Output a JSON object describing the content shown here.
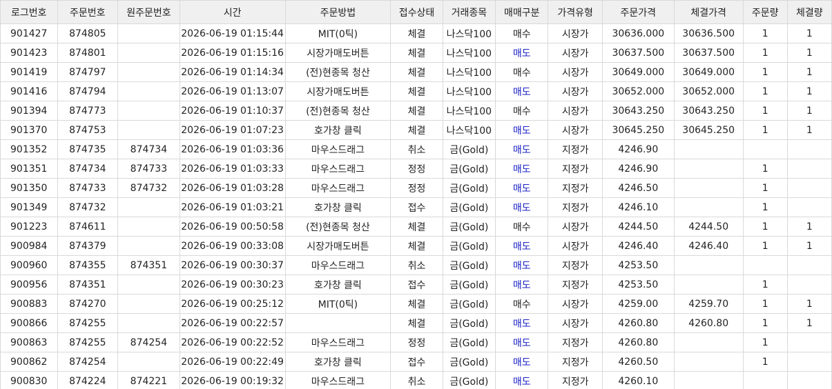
{
  "colors": {
    "header_bg": "#f0f0f0",
    "grid_line": "#d9d9d9",
    "sell_text": "#1a22c4",
    "text": "#222222"
  },
  "table": {
    "columns": [
      {
        "key": "log_no",
        "label": "로그번호"
      },
      {
        "key": "order_no",
        "label": "주문번호"
      },
      {
        "key": "orig_order_no",
        "label": "원주문번호"
      },
      {
        "key": "time",
        "label": "시간"
      },
      {
        "key": "method",
        "label": "주문방법"
      },
      {
        "key": "status",
        "label": "접수상태"
      },
      {
        "key": "symbol",
        "label": "거래종목"
      },
      {
        "key": "side",
        "label": "매매구분"
      },
      {
        "key": "price_type",
        "label": "가격유형"
      },
      {
        "key": "order_price",
        "label": "주문가격"
      },
      {
        "key": "fill_price",
        "label": "체결가격"
      },
      {
        "key": "order_qty",
        "label": "주문량"
      },
      {
        "key": "fill_qty",
        "label": "체결량"
      }
    ],
    "rows": [
      {
        "log_no": "901427",
        "order_no": "874805",
        "orig_order_no": "",
        "time": "2026-06-19 01:15:44",
        "method": "MIT(0틱)",
        "status": "체결",
        "symbol": "나스닥100",
        "side": "매수",
        "price_type": "시장가",
        "order_price": "30636.000",
        "fill_price": "30636.500",
        "order_qty": "1",
        "fill_qty": "1"
      },
      {
        "log_no": "901423",
        "order_no": "874801",
        "orig_order_no": "",
        "time": "2026-06-19 01:15:16",
        "method": "시장가매도버튼",
        "status": "체결",
        "symbol": "나스닥100",
        "side": "매도",
        "price_type": "시장가",
        "order_price": "30637.500",
        "fill_price": "30637.500",
        "order_qty": "1",
        "fill_qty": "1"
      },
      {
        "log_no": "901419",
        "order_no": "874797",
        "orig_order_no": "",
        "time": "2026-06-19 01:14:34",
        "method": "(전)현종목 청산",
        "status": "체결",
        "symbol": "나스닥100",
        "side": "매수",
        "price_type": "시장가",
        "order_price": "30649.000",
        "fill_price": "30649.000",
        "order_qty": "1",
        "fill_qty": "1"
      },
      {
        "log_no": "901416",
        "order_no": "874794",
        "orig_order_no": "",
        "time": "2026-06-19 01:13:07",
        "method": "시장가매도버튼",
        "status": "체결",
        "symbol": "나스닥100",
        "side": "매도",
        "price_type": "시장가",
        "order_price": "30652.000",
        "fill_price": "30652.000",
        "order_qty": "1",
        "fill_qty": "1"
      },
      {
        "log_no": "901394",
        "order_no": "874773",
        "orig_order_no": "",
        "time": "2026-06-19 01:10:37",
        "method": "(전)현종목 청산",
        "status": "체결",
        "symbol": "나스닥100",
        "side": "매수",
        "price_type": "시장가",
        "order_price": "30643.250",
        "fill_price": "30643.250",
        "order_qty": "1",
        "fill_qty": "1"
      },
      {
        "log_no": "901370",
        "order_no": "874753",
        "orig_order_no": "",
        "time": "2026-06-19 01:07:23",
        "method": "호가창 클릭",
        "status": "체결",
        "symbol": "나스닥100",
        "side": "매도",
        "price_type": "시장가",
        "order_price": "30645.250",
        "fill_price": "30645.250",
        "order_qty": "1",
        "fill_qty": "1"
      },
      {
        "log_no": "901352",
        "order_no": "874735",
        "orig_order_no": "874734",
        "time": "2026-06-19 01:03:36",
        "method": "마우스드래그",
        "status": "취소",
        "symbol": "금(Gold)",
        "side": "매도",
        "price_type": "지정가",
        "order_price": "4246.90",
        "fill_price": "",
        "order_qty": "",
        "fill_qty": ""
      },
      {
        "log_no": "901351",
        "order_no": "874734",
        "orig_order_no": "874733",
        "time": "2026-06-19 01:03:33",
        "method": "마우스드래그",
        "status": "정정",
        "symbol": "금(Gold)",
        "side": "매도",
        "price_type": "지정가",
        "order_price": "4246.90",
        "fill_price": "",
        "order_qty": "1",
        "fill_qty": ""
      },
      {
        "log_no": "901350",
        "order_no": "874733",
        "orig_order_no": "874732",
        "time": "2026-06-19 01:03:28",
        "method": "마우스드래그",
        "status": "정정",
        "symbol": "금(Gold)",
        "side": "매도",
        "price_type": "지정가",
        "order_price": "4246.50",
        "fill_price": "",
        "order_qty": "1",
        "fill_qty": ""
      },
      {
        "log_no": "901349",
        "order_no": "874732",
        "orig_order_no": "",
        "time": "2026-06-19 01:03:21",
        "method": "호가창 클릭",
        "status": "접수",
        "symbol": "금(Gold)",
        "side": "매도",
        "price_type": "지정가",
        "order_price": "4246.10",
        "fill_price": "",
        "order_qty": "1",
        "fill_qty": ""
      },
      {
        "log_no": "901223",
        "order_no": "874611",
        "orig_order_no": "",
        "time": "2026-06-19 00:50:58",
        "method": "(전)현종목 청산",
        "status": "체결",
        "symbol": "금(Gold)",
        "side": "매수",
        "price_type": "시장가",
        "order_price": "4244.50",
        "fill_price": "4244.50",
        "order_qty": "1",
        "fill_qty": "1"
      },
      {
        "log_no": "900984",
        "order_no": "874379",
        "orig_order_no": "",
        "time": "2026-06-19 00:33:08",
        "method": "시장가매도버튼",
        "status": "체결",
        "symbol": "금(Gold)",
        "side": "매도",
        "price_type": "시장가",
        "order_price": "4246.40",
        "fill_price": "4246.40",
        "order_qty": "1",
        "fill_qty": "1"
      },
      {
        "log_no": "900960",
        "order_no": "874355",
        "orig_order_no": "874351",
        "time": "2026-06-19 00:30:37",
        "method": "마우스드래그",
        "status": "취소",
        "symbol": "금(Gold)",
        "side": "매도",
        "price_type": "지정가",
        "order_price": "4253.50",
        "fill_price": "",
        "order_qty": "",
        "fill_qty": ""
      },
      {
        "log_no": "900956",
        "order_no": "874351",
        "orig_order_no": "",
        "time": "2026-06-19 00:30:23",
        "method": "호가창 클릭",
        "status": "접수",
        "symbol": "금(Gold)",
        "side": "매도",
        "price_type": "지정가",
        "order_price": "4253.50",
        "fill_price": "",
        "order_qty": "1",
        "fill_qty": ""
      },
      {
        "log_no": "900883",
        "order_no": "874270",
        "orig_order_no": "",
        "time": "2026-06-19 00:25:12",
        "method": "MIT(0틱)",
        "status": "체결",
        "symbol": "금(Gold)",
        "side": "매수",
        "price_type": "시장가",
        "order_price": "4259.00",
        "fill_price": "4259.70",
        "order_qty": "1",
        "fill_qty": "1"
      },
      {
        "log_no": "900866",
        "order_no": "874255",
        "orig_order_no": "",
        "time": "2026-06-19 00:22:57",
        "method": "",
        "status": "체결",
        "symbol": "금(Gold)",
        "side": "매도",
        "price_type": "시장가",
        "order_price": "4260.80",
        "fill_price": "4260.80",
        "order_qty": "1",
        "fill_qty": "1"
      },
      {
        "log_no": "900863",
        "order_no": "874255",
        "orig_order_no": "874254",
        "time": "2026-06-19 00:22:52",
        "method": "마우스드래그",
        "status": "정정",
        "symbol": "금(Gold)",
        "side": "매도",
        "price_type": "지정가",
        "order_price": "4260.80",
        "fill_price": "",
        "order_qty": "1",
        "fill_qty": ""
      },
      {
        "log_no": "900862",
        "order_no": "874254",
        "orig_order_no": "",
        "time": "2026-06-19 00:22:49",
        "method": "호가창 클릭",
        "status": "접수",
        "symbol": "금(Gold)",
        "side": "매도",
        "price_type": "지정가",
        "order_price": "4260.50",
        "fill_price": "",
        "order_qty": "1",
        "fill_qty": ""
      },
      {
        "log_no": "900830",
        "order_no": "874224",
        "orig_order_no": "874221",
        "time": "2026-06-19 00:19:32",
        "method": "마우스드래그",
        "status": "취소",
        "symbol": "금(Gold)",
        "side": "매도",
        "price_type": "지정가",
        "order_price": "4260.10",
        "fill_price": "",
        "order_qty": "",
        "fill_qty": ""
      }
    ]
  }
}
